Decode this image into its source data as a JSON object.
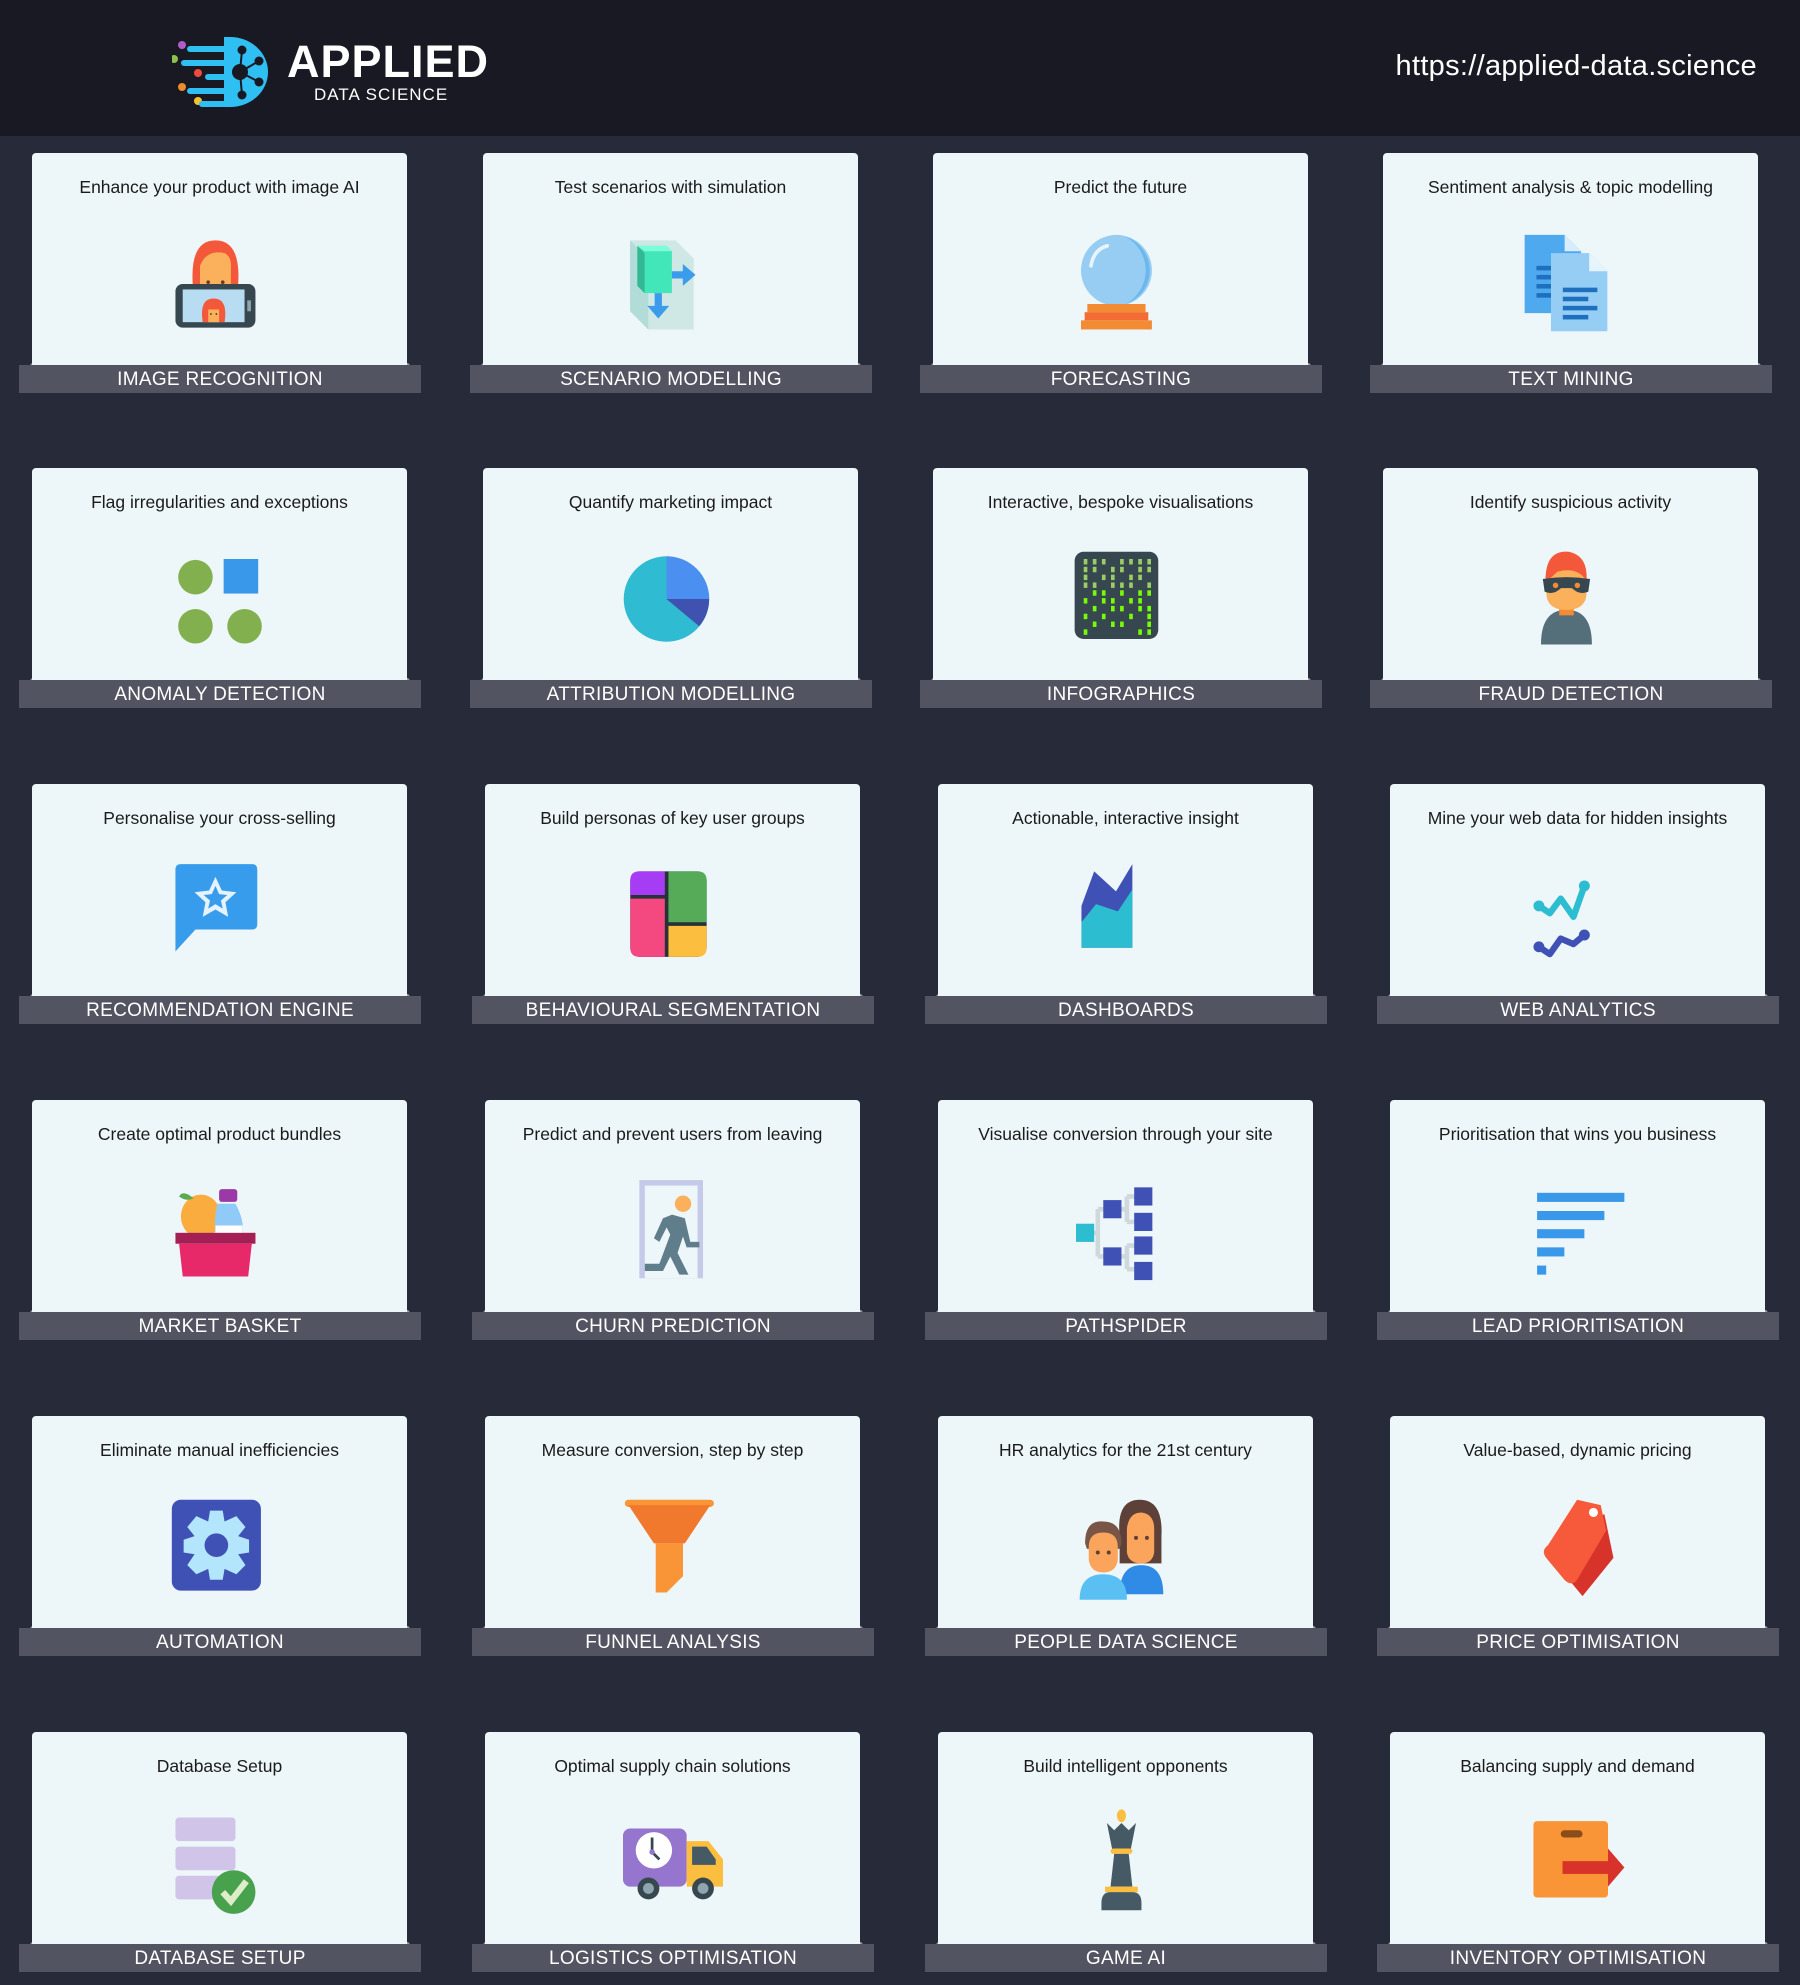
{
  "header": {
    "logo_title": "APPLIED",
    "logo_subtitle": "DATA SCIENCE",
    "site_url": "https://applied-data.science"
  },
  "colors": {
    "header_bg": "#181923",
    "page_bg": "#272a38",
    "card_bg": "#edf6f9",
    "card_base": "#525462",
    "logo_blue": "#2fbff2"
  },
  "cards": [
    {
      "title": "IMAGE RECOGNITION",
      "description": "Enhance your product with image AI",
      "icon": "selfie-phone-icon"
    },
    {
      "title": "SCENARIO MODELLING",
      "description": "Test scenarios with simulation",
      "icon": "cube-arrows-icon"
    },
    {
      "title": "FORECASTING",
      "description": "Predict the future",
      "icon": "crystal-ball-icon"
    },
    {
      "title": "TEXT MINING",
      "description": "Sentiment analysis & topic modelling",
      "icon": "documents-icon"
    },
    {
      "title": "ANOMALY DETECTION",
      "description": "Flag irregularities and exceptions",
      "icon": "odd-one-out-icon"
    },
    {
      "title": "ATTRIBUTION MODELLING",
      "description": "Quantify marketing impact",
      "icon": "pie-chart-icon"
    },
    {
      "title": "INFOGRAPHICS",
      "description": "Interactive, bespoke visualisations",
      "icon": "data-matrix-icon"
    },
    {
      "title": "FRAUD DETECTION",
      "description": "Identify suspicious activity",
      "icon": "masked-thief-icon"
    },
    {
      "title": "RECOMMENDATION ENGINE",
      "description": "Personalise your cross-selling",
      "icon": "star-speech-bubble-icon"
    },
    {
      "title": "BEHAVIOURAL SEGMENTATION",
      "description": "Build personas of key user groups",
      "icon": "segments-icon"
    },
    {
      "title": "DASHBOARDS",
      "description": "Actionable, interactive insight",
      "icon": "area-chart-icon"
    },
    {
      "title": "WEB ANALYTICS",
      "description": "Mine your web data for hidden insights",
      "icon": "line-graph-icon"
    },
    {
      "title": "MARKET BASKET",
      "description": "Create optimal product bundles",
      "icon": "shopping-basket-icon"
    },
    {
      "title": "CHURN PREDICTION",
      "description": "Predict and prevent users from leaving",
      "icon": "exit-door-icon"
    },
    {
      "title": "PATHSPIDER",
      "description": "Visualise conversion through your site",
      "icon": "tree-diagram-icon"
    },
    {
      "title": "LEAD PRIORITISATION",
      "description": "Prioritisation that wins you business",
      "icon": "sorted-bars-icon"
    },
    {
      "title": "AUTOMATION",
      "description": "Eliminate manual inefficiencies",
      "icon": "gear-icon"
    },
    {
      "title": "FUNNEL ANALYSIS",
      "description": "Measure conversion, step by step",
      "icon": "funnel-icon"
    },
    {
      "title": "PEOPLE DATA SCIENCE",
      "description": "HR analytics for the 21st century",
      "icon": "people-icon"
    },
    {
      "title": "PRICE OPTIMISATION",
      "description": "Value-based, dynamic pricing",
      "icon": "price-tags-icon"
    },
    {
      "title": "DATABASE SETUP",
      "description": "Database Setup",
      "icon": "database-check-icon"
    },
    {
      "title": "LOGISTICS OPTIMISATION",
      "description": "Optimal supply chain solutions",
      "icon": "delivery-truck-icon"
    },
    {
      "title": "GAME AI",
      "description": "Build intelligent opponents",
      "icon": "chess-queen-icon"
    },
    {
      "title": "INVENTORY OPTIMISATION",
      "description": "Balancing supply and demand",
      "icon": "box-arrow-icon"
    }
  ]
}
